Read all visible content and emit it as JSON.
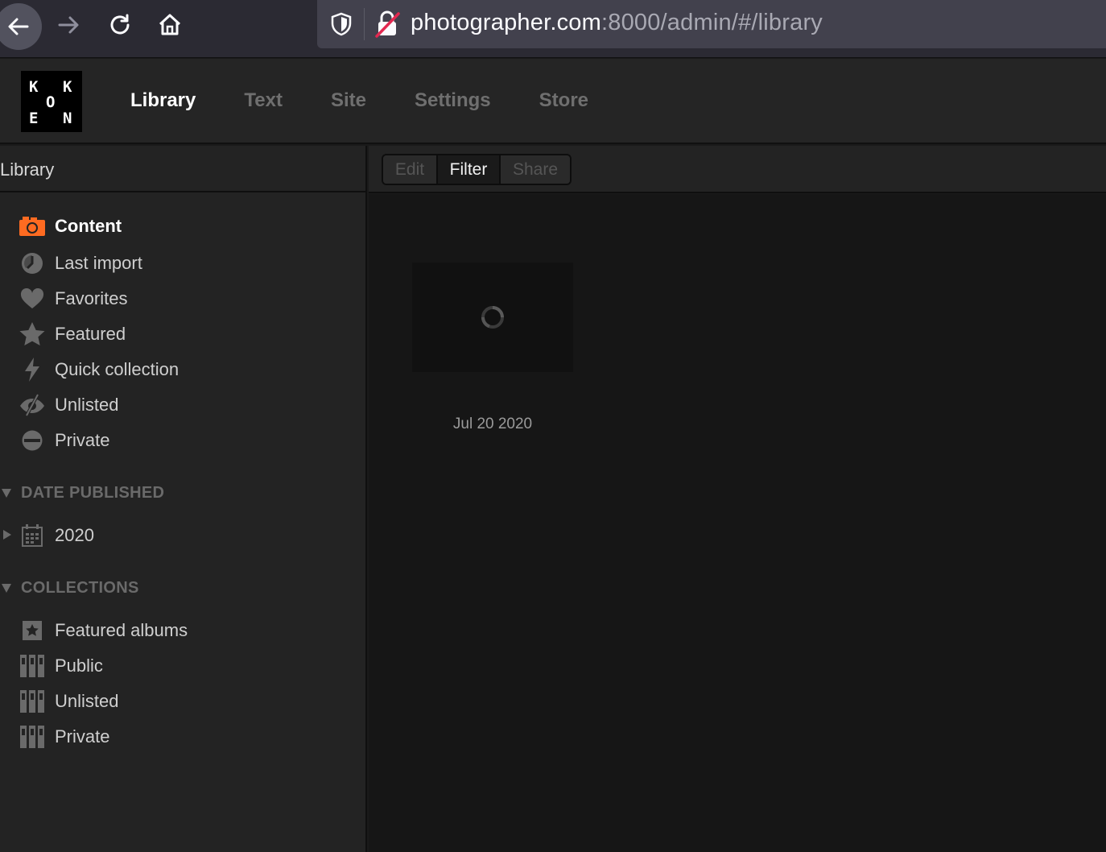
{
  "browser": {
    "url_host": "photographer.com",
    "url_rest": ":8000/admin/#/library"
  },
  "app": {
    "logo_letters": [
      "K",
      "K",
      "O",
      "E",
      "N"
    ],
    "nav": [
      {
        "label": "Library",
        "active": true
      },
      {
        "label": "Text",
        "active": false
      },
      {
        "label": "Site",
        "active": false
      },
      {
        "label": "Settings",
        "active": false
      },
      {
        "label": "Store",
        "active": false
      }
    ]
  },
  "sidebar": {
    "title": "Library",
    "items": [
      {
        "label": "Content",
        "icon": "camera-icon",
        "active": true
      },
      {
        "label": "Last import",
        "icon": "clock-icon"
      },
      {
        "label": "Favorites",
        "icon": "heart-icon"
      },
      {
        "label": "Featured",
        "icon": "star-icon"
      },
      {
        "label": "Quick collection",
        "icon": "lightning-icon"
      },
      {
        "label": "Unlisted",
        "icon": "eye-slash-icon"
      },
      {
        "label": "Private",
        "icon": "no-entry-icon"
      }
    ],
    "date_section": {
      "title": "DATE PUBLISHED",
      "items": [
        {
          "label": "2020",
          "icon": "calendar-icon"
        }
      ]
    },
    "collections_section": {
      "title": "COLLECTIONS",
      "items": [
        {
          "label": "Featured albums",
          "icon": "featured-album-icon"
        },
        {
          "label": "Public",
          "icon": "album-stack-icon"
        },
        {
          "label": "Unlisted",
          "icon": "album-stack-icon"
        },
        {
          "label": "Private",
          "icon": "album-stack-icon"
        }
      ]
    }
  },
  "toolbar": {
    "buttons": [
      {
        "label": "Edit",
        "state": "disabled"
      },
      {
        "label": "Filter",
        "state": "active"
      },
      {
        "label": "Share",
        "state": "disabled"
      }
    ]
  },
  "content": {
    "thumbnails": [
      {
        "date": "Jul 20 2020",
        "loading": true
      }
    ]
  },
  "colors": {
    "accent": "#ff6b21",
    "background": "#161616",
    "sidebar": "#232323"
  }
}
